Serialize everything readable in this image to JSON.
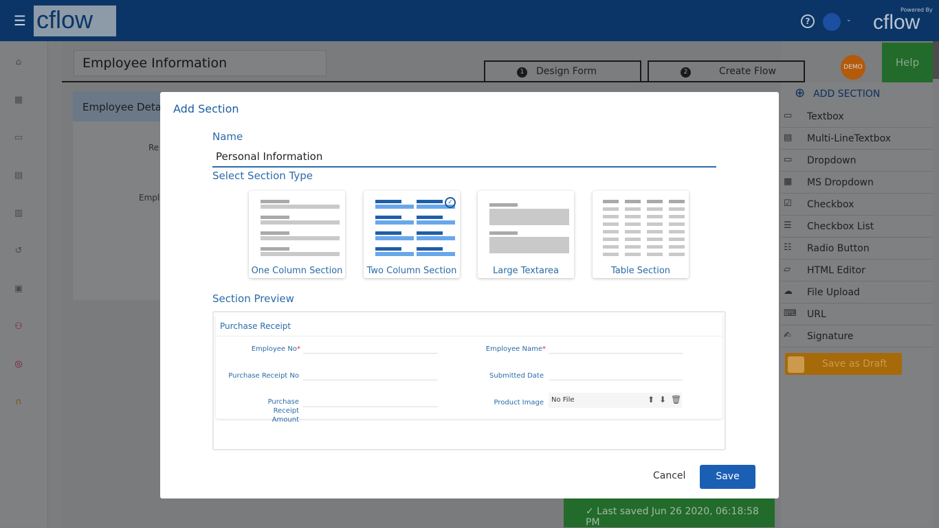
{
  "header": {
    "logo": "cflow",
    "powered_by": "Powered By",
    "powered_logo": "cflow",
    "help_icon": "question-circle-icon"
  },
  "sidebar": {
    "items": [
      "home-icon",
      "apps-icon",
      "calendar-icon",
      "inbox-icon",
      "document-icon",
      "history-icon",
      "report-icon",
      "workflow-icon",
      "settings-icon",
      "support-icon"
    ]
  },
  "page": {
    "form_title": "Employee Information",
    "section_header": "Employee Details",
    "field_1": "Re",
    "field_2": "Empl"
  },
  "tabs": [
    {
      "num": "1",
      "label": "Design Form"
    },
    {
      "num": "2",
      "label": "Create Flow"
    }
  ],
  "demo_badge": "DEMO",
  "help_label": "Help",
  "right_panel": {
    "add_section": "ADD SECTION",
    "items": [
      "Textbox",
      "Multi-LineTextbox",
      "Dropdown",
      "MS Dropdown",
      "Checkbox",
      "Checkbox List",
      "Radio Button",
      "HTML Editor",
      "File Upload",
      "URL",
      "Signature"
    ],
    "save_draft": "Save as Draft"
  },
  "status": "✓  Last saved Jun 26 2020, 06:18:58 PM",
  "modal": {
    "title": "Add Section",
    "name_label": "Name",
    "name_value": "Personal Information",
    "type_label": "Select Section Type",
    "types": [
      {
        "label": "One Column Section",
        "selected": false
      },
      {
        "label": "Two Column Section",
        "selected": true
      },
      {
        "label": "Large Textarea",
        "selected": false
      },
      {
        "label": "Table Section",
        "selected": false
      }
    ],
    "preview_label": "Section Preview",
    "preview": {
      "title": "Purchase Receipt",
      "fields": [
        "Employee No",
        "Employee Name",
        "Purchase Receipt No",
        "Submitted Date",
        "Purchase Receipt Amount",
        "Product Image"
      ],
      "required_mark": "*",
      "file_value": "No File"
    },
    "cancel": "Cancel",
    "save": "Save"
  },
  "colors": {
    "accent": "#1b5fb5",
    "header": "#0b3566",
    "help": "#226b2b",
    "draft": "#a66a0a"
  }
}
